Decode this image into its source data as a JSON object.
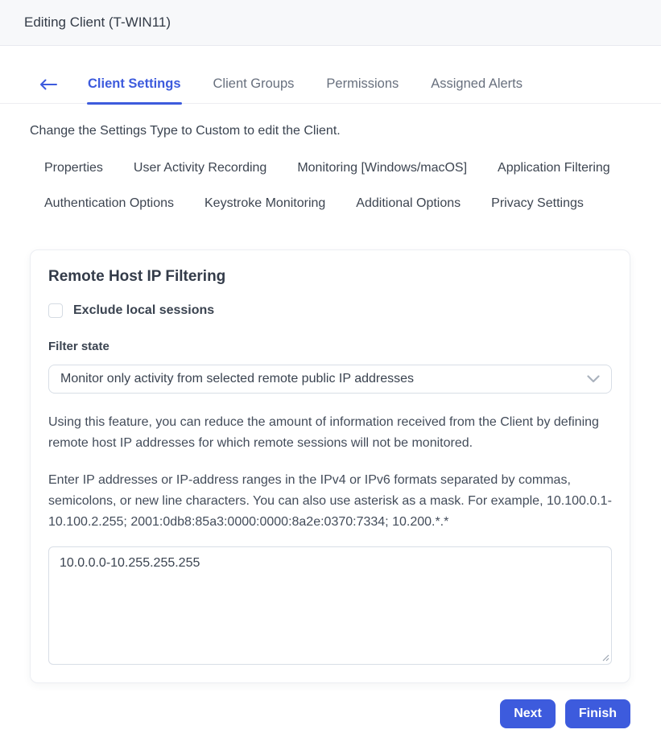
{
  "header": {
    "title": "Editing Client (T-WIN11)"
  },
  "tabs": {
    "back_icon": "arrow-left",
    "items": [
      {
        "label": "Client Settings",
        "active": true
      },
      {
        "label": "Client Groups",
        "active": false
      },
      {
        "label": "Permissions",
        "active": false
      },
      {
        "label": "Assigned Alerts",
        "active": false
      }
    ]
  },
  "notice": "Change the Settings Type to Custom to edit the Client.",
  "subtabs": [
    "Properties",
    "User Activity Recording",
    "Monitoring [Windows/macOS]",
    "Application Filtering",
    "Authentication Options",
    "Keystroke Monitoring",
    "Additional Options",
    "Privacy Settings"
  ],
  "card": {
    "title": "Remote Host IP Filtering",
    "exclude_checkbox": {
      "label": "Exclude local sessions",
      "checked": false
    },
    "filter_state": {
      "label": "Filter state",
      "selected_value": "Monitor only activity from selected remote public IP addresses",
      "chevron_icon": "chevron-down"
    },
    "description_1": "Using this feature, you can reduce the amount of information received from the Client by defining remote host IP addresses for which remote sessions will not be monitored.",
    "description_2": "Enter IP addresses or IP-address ranges in the IPv4 or IPv6 formats separated by commas, semicolons, or new line characters. You can also use asterisk as a mask. For example, 10.100.0.1-10.100.2.255; 2001:0db8:85a3:0000:0000:8a2e:0370:7334; 10.200.*.*",
    "ip_list_value": "10.0.0.0-10.255.255.255",
    "resize_handle_icon": "resize-grip"
  },
  "footer": {
    "next_label": "Next",
    "finish_label": "Finish"
  },
  "colors": {
    "accent": "#3d5bdd",
    "header_bg": "#f7f8fa",
    "border": "#d8dee6",
    "text": "#3a4350",
    "tab_inactive": "#68707e"
  }
}
